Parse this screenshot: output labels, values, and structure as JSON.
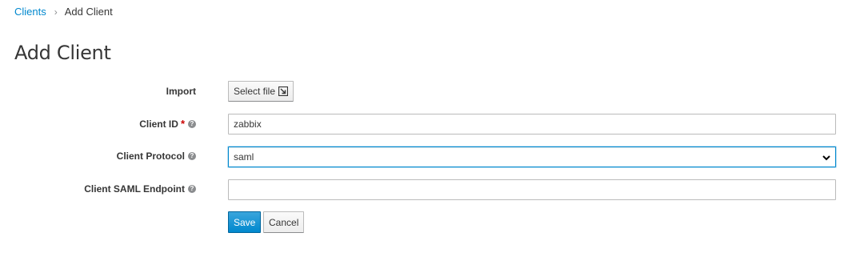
{
  "breadcrumb": {
    "parent": "Clients",
    "separator": "›",
    "current": "Add Client"
  },
  "page": {
    "title": "Add Client"
  },
  "form": {
    "import": {
      "label": "Import",
      "button_label": "Select file",
      "icon": "import-icon"
    },
    "client_id": {
      "label": "Client ID",
      "required_marker": "*",
      "value": "zabbix",
      "help_icon": "help-icon"
    },
    "client_protocol": {
      "label": "Client Protocol",
      "selected": "saml",
      "help_icon": "help-icon"
    },
    "client_saml_endpoint": {
      "label": "Client SAML Endpoint",
      "value": "",
      "help_icon": "help-icon"
    }
  },
  "actions": {
    "save_label": "Save",
    "cancel_label": "Cancel"
  },
  "colors": {
    "link": "#0088ce",
    "primary": "#0088ce",
    "required": "#cc0000",
    "text": "#363636"
  }
}
